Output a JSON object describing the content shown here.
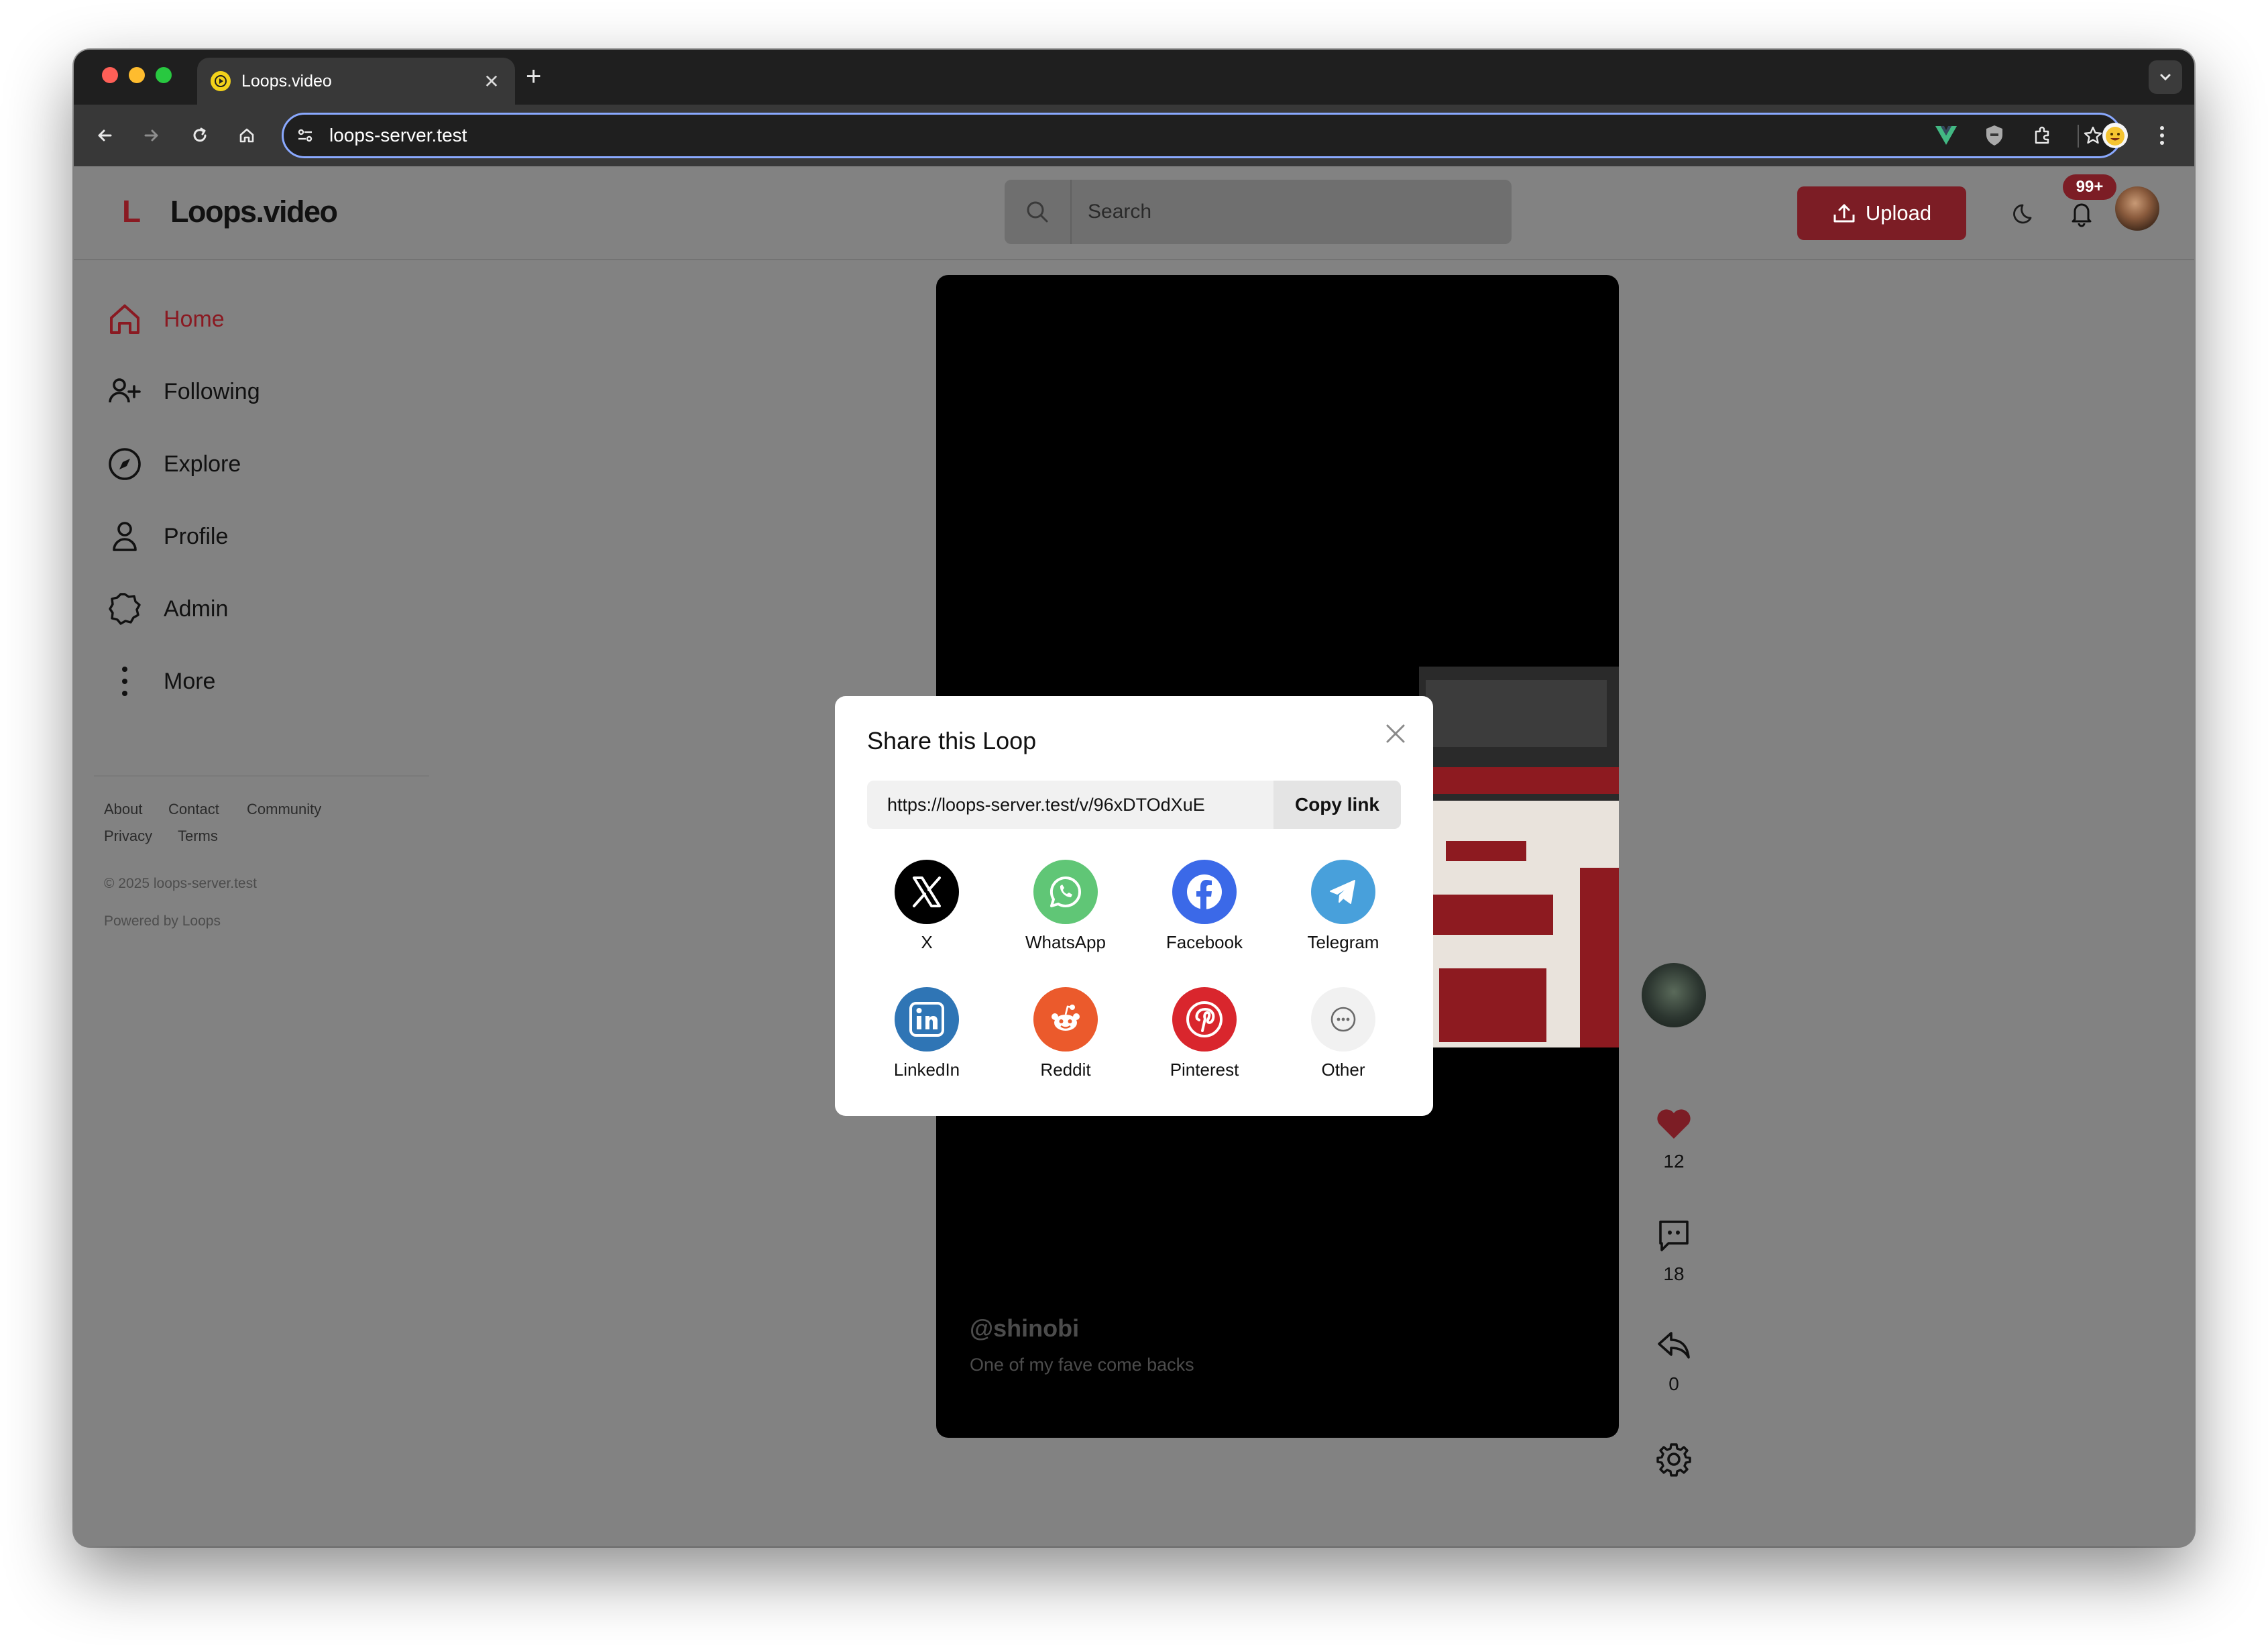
{
  "browser": {
    "tab_title": "Loops.video",
    "new_tab_symbol": "+",
    "url": "loops-server.test"
  },
  "header": {
    "logo_mark": "L",
    "logo_text": "Loops.video",
    "search_placeholder": "Search",
    "upload_label": "Upload",
    "notification_badge": "99+"
  },
  "sidebar": {
    "items": [
      {
        "label": "Home",
        "icon": "home-icon",
        "active": true
      },
      {
        "label": "Following",
        "icon": "user-plus-icon"
      },
      {
        "label": "Explore",
        "icon": "compass-icon"
      },
      {
        "label": "Profile",
        "icon": "user-icon"
      },
      {
        "label": "Admin",
        "icon": "badge-icon"
      },
      {
        "label": "More",
        "icon": "more-vertical-icon"
      }
    ],
    "footer_links": [
      "About",
      "Contact",
      "Community",
      "Privacy",
      "Terms"
    ],
    "copyright": "© 2025 loops-server.test",
    "powered_by": "Powered by Loops"
  },
  "video": {
    "username": "@shinobi",
    "caption": "One of my fave come backs"
  },
  "actions": {
    "likes": "12",
    "comments": "18",
    "shares": "0"
  },
  "share_modal": {
    "title": "Share this Loop",
    "link": "https://loops-server.test/v/96xDTOdXuE",
    "copy_label": "Copy link",
    "options": [
      {
        "label": "X",
        "icon": "x-logo-icon",
        "color": "#000000"
      },
      {
        "label": "WhatsApp",
        "icon": "whatsapp-icon",
        "color": "#60c676"
      },
      {
        "label": "Facebook",
        "icon": "facebook-icon",
        "color": "#3b69e8"
      },
      {
        "label": "Telegram",
        "icon": "telegram-icon",
        "color": "#48a0db"
      },
      {
        "label": "LinkedIn",
        "icon": "linkedin-icon",
        "color": "#2f75b5"
      },
      {
        "label": "Reddit",
        "icon": "reddit-icon",
        "color": "#eb5a2c"
      },
      {
        "label": "Pinterest",
        "icon": "pinterest-icon",
        "color": "#d9262d"
      },
      {
        "label": "Other",
        "icon": "more-horizontal-icon",
        "color": "#f1f1f1"
      }
    ]
  },
  "colors": {
    "brand": "#8a1a22",
    "backdrop": "#828282"
  }
}
